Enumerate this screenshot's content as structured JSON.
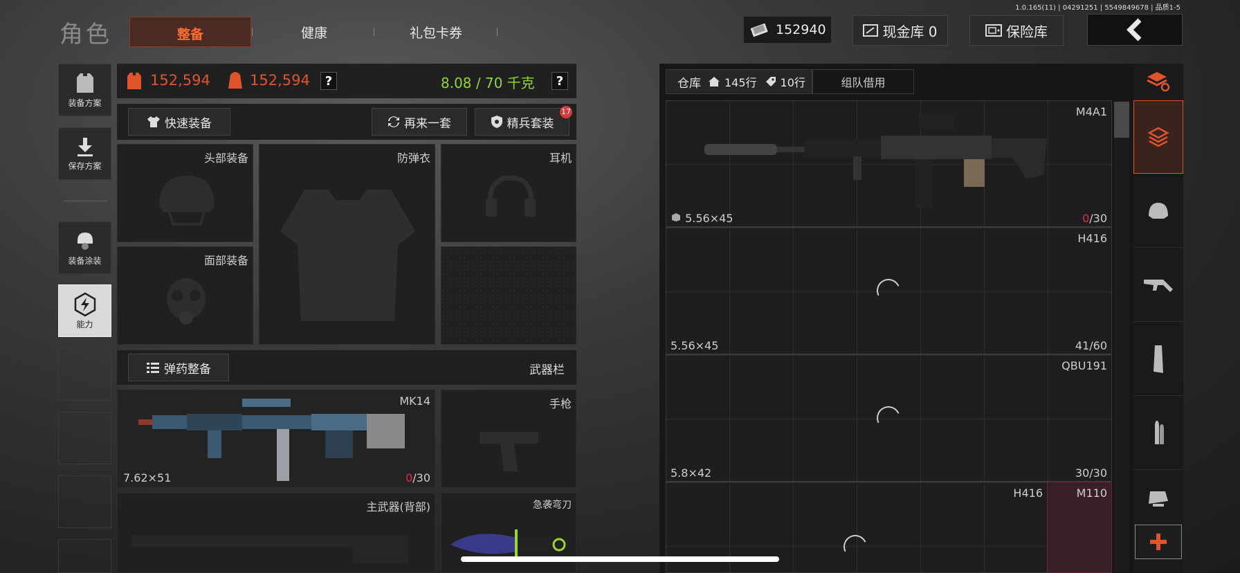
{
  "header": {
    "build_info": "1.0.165(11) | 04291251 | 5549849678 | 品质1-5",
    "title": "角色",
    "tabs": [
      "整备",
      "健康",
      "礼包卡券"
    ],
    "currency_value": "152940",
    "cash_vault_label": "现金库 0",
    "safe_label": "保险库",
    "back_icon": "chevron-left-icon"
  },
  "left_nav": {
    "items": [
      {
        "label": "装备方案",
        "icon": "vest-icon"
      },
      {
        "label": "保存方案",
        "icon": "download-icon"
      },
      {
        "label": "装备涂装",
        "icon": "helmet-paint-icon"
      },
      {
        "label": "能力",
        "icon": "lightning-icon"
      }
    ]
  },
  "stats": {
    "value1": "152,594",
    "value2": "152,594",
    "weight": "8.08 / 70 千克",
    "help": "?"
  },
  "actions": {
    "quick_equip": "快速装备",
    "again": "再来一套",
    "elite": "精兵套装",
    "elite_badge": "17",
    "ammo_equip": "弹药整备",
    "weapon_bar": "武器栏"
  },
  "slots": {
    "head": "头部装备",
    "vest": "防弹衣",
    "headset": "耳机",
    "face": "面部装备",
    "pistol": "手枪",
    "backup": "主武器(背部)",
    "melee": "急袭弯刀"
  },
  "primary": {
    "name": "MK14",
    "caliber": "7.62×51",
    "ammo_cur": "0",
    "ammo_max": "/30"
  },
  "warehouse": {
    "tab_label": "仓库",
    "rows_home": "145行",
    "rows_tag": "10行",
    "team_label": "组队借用",
    "items": [
      {
        "name": "M4A1",
        "caliber": "5.56×45",
        "ammo_cur": "0",
        "ammo_max": "/30"
      },
      {
        "name": "H416",
        "caliber": "5.56×45",
        "ammo": "41/60"
      },
      {
        "name": "QBU191",
        "caliber": "5.8×42",
        "ammo": "30/30"
      },
      {
        "name": "H416",
        "second": "M110"
      }
    ]
  },
  "right_rail": {
    "icons": [
      "stack-refresh-icon",
      "stack-icon",
      "helmet-icon",
      "rifle-icon",
      "magazine-icon",
      "bullet-icon",
      "scope-icon",
      "plus-icon"
    ],
    "accent": "#e0542b"
  }
}
